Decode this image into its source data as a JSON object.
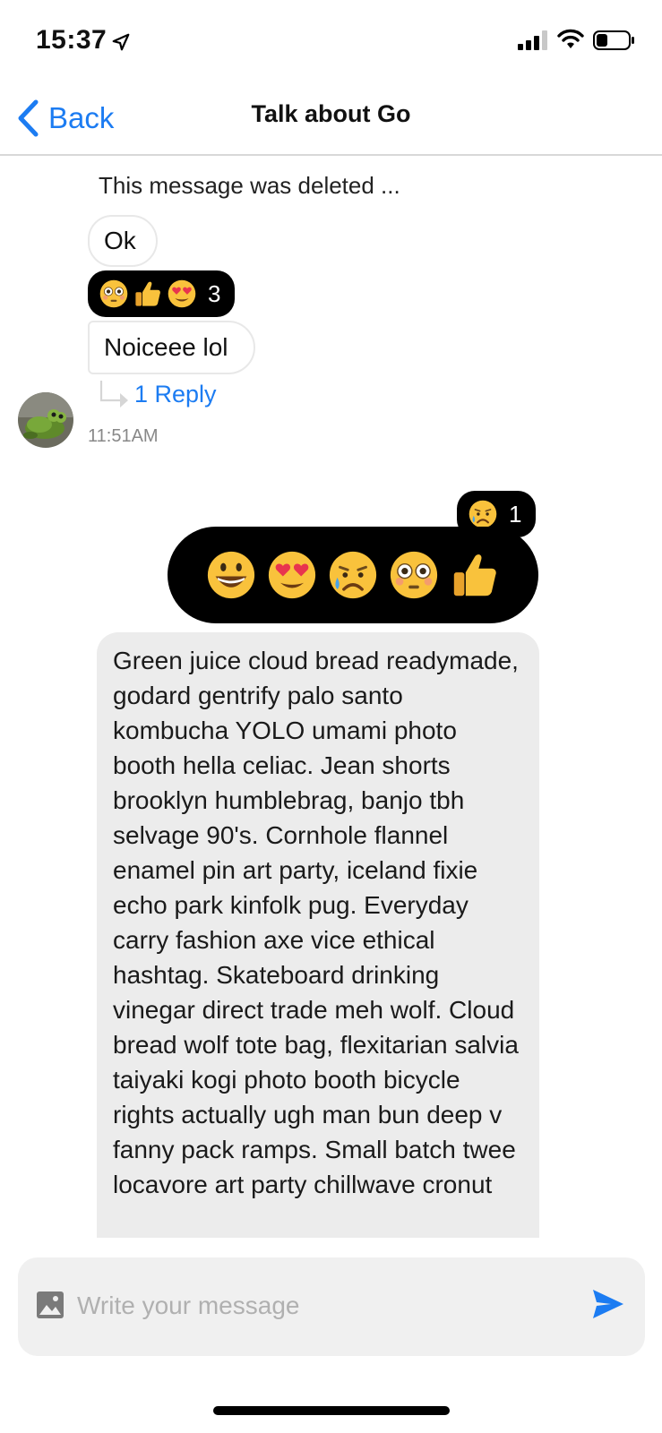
{
  "status_bar": {
    "time": "15:37"
  },
  "nav": {
    "back_label": "Back",
    "title": "Talk about Go"
  },
  "messages": {
    "deleted_text": "This message was deleted ...",
    "ok_text": "Ok",
    "reactions_first": {
      "count": "3",
      "emojis": [
        "flushed-face",
        "thumbs-up",
        "heart-eyes"
      ]
    },
    "noice_text": "Noiceee lol",
    "reply_link": "1 Reply",
    "timestamp": "11:51AM",
    "reactions_second": {
      "count": "1",
      "emojis": [
        "sad-sweat-face"
      ]
    },
    "picker_emojis": [
      "grinning-face",
      "heart-eyes",
      "sad-sweat-face",
      "flushed-face",
      "thumbs-up"
    ],
    "long_text": "Green juice cloud bread readymade, godard gentrify palo santo kombucha YOLO umami photo booth hella celiac. Jean shorts brooklyn humblebrag, banjo tbh selvage 90's. Cornhole flannel enamel pin art party, iceland fixie echo park kinfolk pug. Everyday carry fashion axe vice ethical hashtag. Skateboard drinking vinegar direct trade meh wolf. Cloud bread wolf tote bag, flexitarian salvia taiyaki kogi photo booth bicycle rights actually ugh man bun deep v fanny pack ramps. Small batch twee locavore art party chillwave cronut"
  },
  "composer": {
    "placeholder": "Write your message",
    "value": ""
  },
  "colors": {
    "accent": "#1c7cf2",
    "reaction_bg": "#000000",
    "own_bubble": "#ececec"
  }
}
